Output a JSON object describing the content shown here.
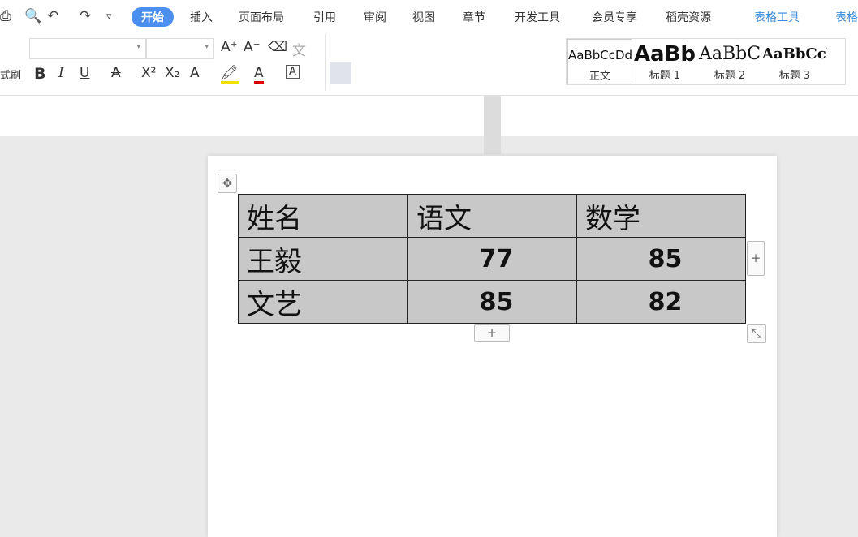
{
  "quick": {
    "print": "⎙",
    "preview": "🔍",
    "undo": "↶",
    "redo": "↷",
    "more": "▿"
  },
  "tabs": [
    "开始",
    "插入",
    "页面布局",
    "引用",
    "审阅",
    "视图",
    "章节",
    "开发工具",
    "会员专享",
    "稻壳资源",
    "表格工具",
    "表格"
  ],
  "ribbon": {
    "format_painter": "式刷",
    "bold": "B",
    "italic": "I",
    "underline": "U",
    "strike": "A",
    "superscript": "X²",
    "subscript": "X₂",
    "text_effect": "A",
    "highlight": "🖍",
    "font_color": "A",
    "char_border": "A",
    "grow": "A⁺",
    "shrink": "A⁻",
    "clear": "⌫",
    "pinyin": "文"
  },
  "styles": [
    {
      "preview": "AaBbCcDd",
      "name": "正文"
    },
    {
      "preview": "AaBb",
      "name": "标题 1"
    },
    {
      "preview": "AaBbC",
      "name": "标题 2"
    },
    {
      "preview": "AaBbCcI",
      "name": "标题 3"
    }
  ],
  "table": {
    "header": [
      "姓名",
      "语文",
      "数学"
    ],
    "rows": [
      [
        "王毅",
        "77",
        "85"
      ],
      [
        "文艺",
        "85",
        "82"
      ]
    ]
  },
  "controls": {
    "move": "✥",
    "add": "+",
    "resize": "⤡"
  }
}
